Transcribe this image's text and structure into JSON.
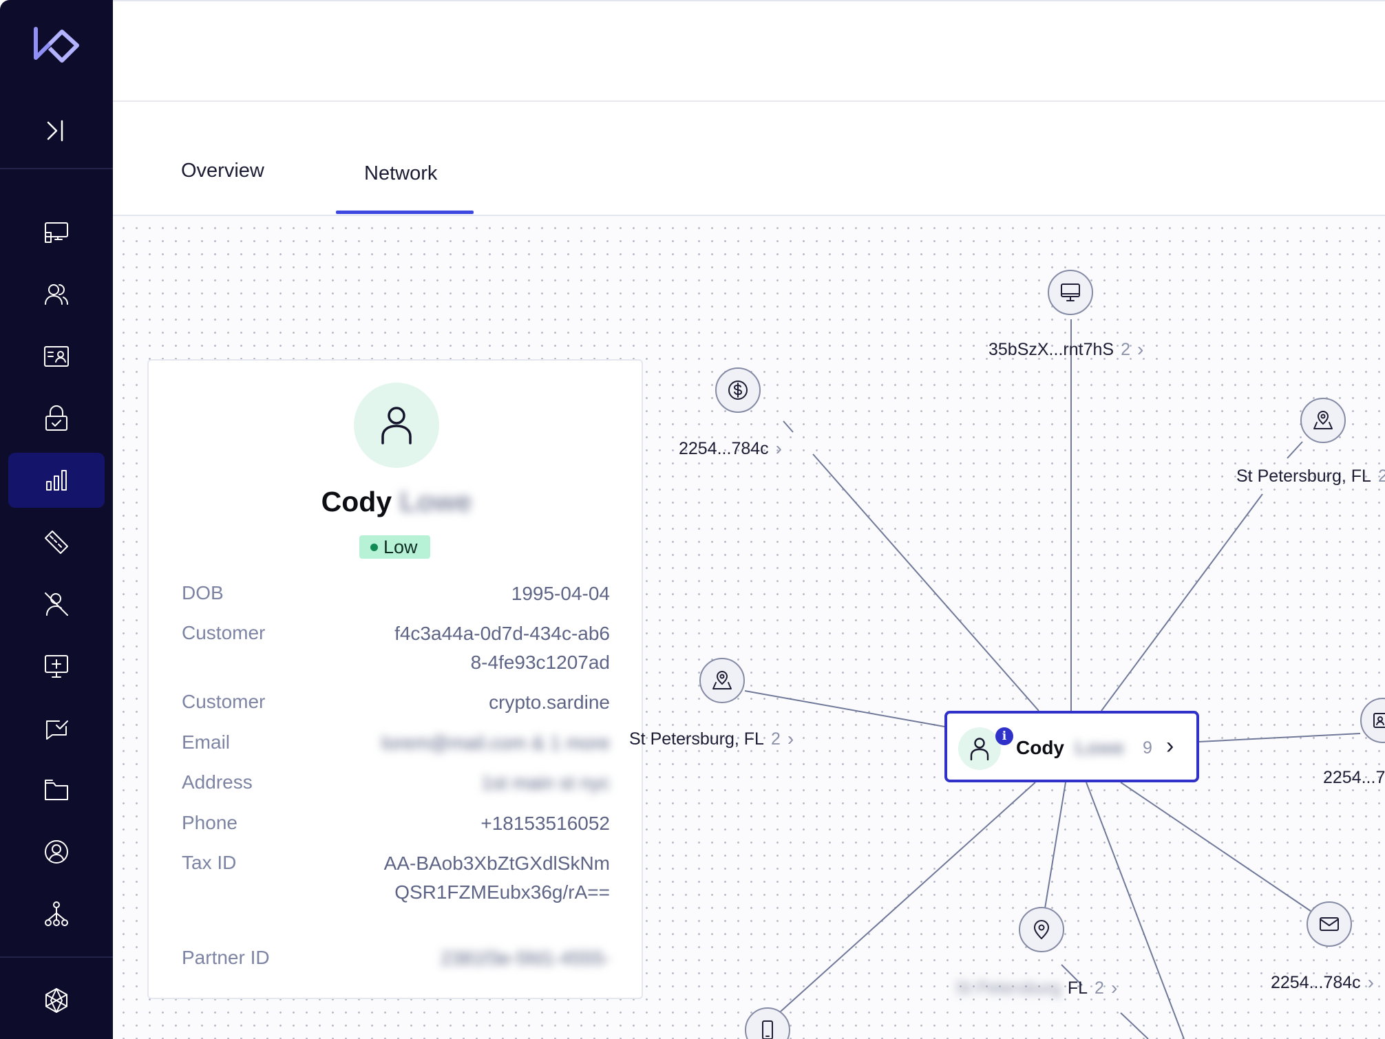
{
  "sidebar": {
    "items": [
      {
        "name": "dashboard-icon"
      },
      {
        "name": "users-icon"
      },
      {
        "name": "id-card-icon"
      },
      {
        "name": "lock-check-icon"
      },
      {
        "name": "analytics-icon",
        "active": true
      },
      {
        "name": "ruler-icon"
      },
      {
        "name": "user-blocked-icon"
      },
      {
        "name": "monitor-plus-icon"
      },
      {
        "name": "chat-check-icon"
      },
      {
        "name": "folder-icon"
      },
      {
        "name": "user-circle-icon"
      },
      {
        "name": "network-icon"
      },
      {
        "name": "settings-hex-icon"
      }
    ]
  },
  "tabs": [
    {
      "label": "Overview",
      "active": false
    },
    {
      "label": "Network",
      "active": true
    }
  ],
  "profile": {
    "first_name": "Cody",
    "last_name": "Lowe",
    "risk": "Low",
    "rows": [
      {
        "label": "DOB",
        "value": "1995-04-04"
      },
      {
        "label": "Customer",
        "value": "f4c3a44a-0d7d-434c-ab68-4fe93c1207ad"
      },
      {
        "label": "Customer",
        "value": "crypto.sardine"
      },
      {
        "label": "Email",
        "value": "lorem@mail.com & 1 more"
      },
      {
        "label": "Address",
        "value": "1st main st nyc"
      },
      {
        "label": "Phone",
        "value": "+18153516052"
      },
      {
        "label": "Tax ID",
        "value": "AA-BAob3XbZtGXdlSkNmQSR1FZMEubx36g/rA=="
      },
      {
        "label": "Partner ID",
        "value": "2381f3e-5fd1-4555-"
      }
    ]
  },
  "network": {
    "center": {
      "first_name": "Cody",
      "last_name": "Lowe",
      "count": "9",
      "info": "i"
    },
    "nodes": [
      {
        "type": "device",
        "label": "35bSzX...rnt7hS",
        "count": "2"
      },
      {
        "type": "payment",
        "label": "2254...784c",
        "count": ""
      },
      {
        "type": "location",
        "label": "St Petersburg, FL",
        "count": "2"
      },
      {
        "type": "location",
        "label": "St Petersburg, FL",
        "count": "2"
      },
      {
        "type": "id-card",
        "label": "2254...7",
        "count": ""
      },
      {
        "type": "location-pin",
        "label_blurred": "St Petersburg",
        "label": "FL",
        "count": "2"
      },
      {
        "type": "email",
        "label": "2254...784c",
        "count": ""
      },
      {
        "type": "phone",
        "label": "",
        "count": ""
      }
    ]
  }
}
